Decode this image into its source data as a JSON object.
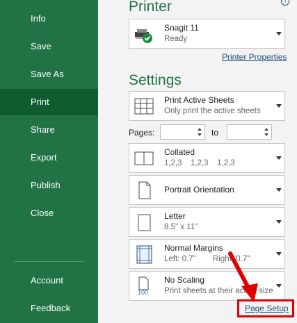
{
  "sidebar": {
    "items": [
      {
        "label": "Info"
      },
      {
        "label": "Save"
      },
      {
        "label": "Save As"
      },
      {
        "label": "Print"
      },
      {
        "label": "Share"
      },
      {
        "label": "Export"
      },
      {
        "label": "Publish"
      },
      {
        "label": "Close"
      }
    ],
    "bottom": [
      {
        "label": "Account"
      },
      {
        "label": "Feedback"
      }
    ],
    "active": "Print"
  },
  "printer": {
    "heading": "Printer",
    "info_icon": "i",
    "name": "Snagit 11",
    "status": "Ready",
    "properties_link": "Printer Properties"
  },
  "settings": {
    "heading": "Settings",
    "print_what": {
      "title": "Print Active Sheets",
      "subtitle": "Only print the active sheets"
    },
    "pages": {
      "label": "Pages:",
      "to_label": "to",
      "from_value": "",
      "to_value": ""
    },
    "collation": {
      "title": "Collated",
      "subtitle": [
        "1,2,3",
        "1,2,3",
        "1,2,3"
      ]
    },
    "orientation": {
      "title": "Portrait Orientation"
    },
    "paper": {
      "title": "Letter",
      "subtitle": "8.5\" x 11\""
    },
    "margins": {
      "title": "Normal Margins",
      "subtitle_left": "Left:  0.7\"",
      "subtitle_right": "Right:  0.7\""
    },
    "scaling": {
      "title": "No Scaling",
      "subtitle": "Print sheets at their actual size",
      "icon_text": "100"
    },
    "page_setup_link": "Page Setup"
  },
  "colors": {
    "accent": "#217346",
    "highlight_box": "#e00000",
    "arrow": "#e00000"
  }
}
